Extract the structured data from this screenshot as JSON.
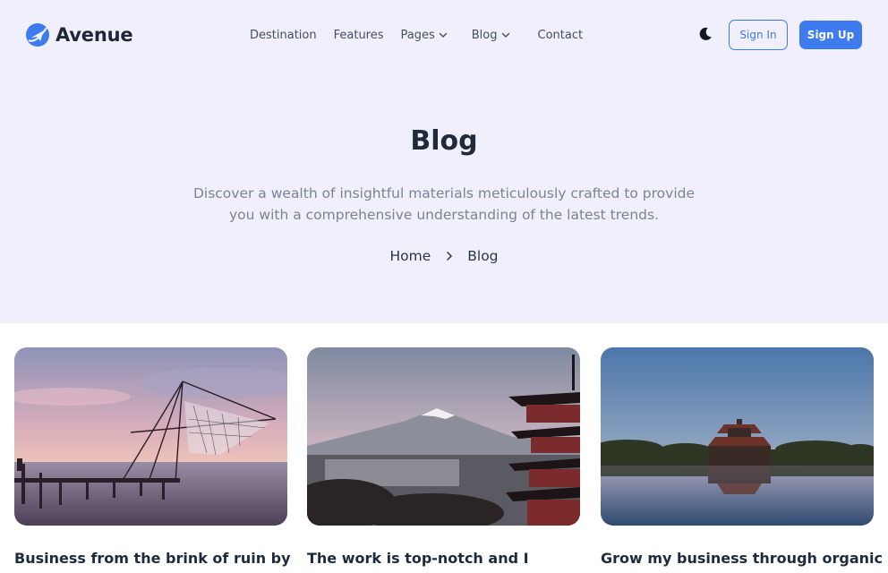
{
  "header": {
    "brand": "Avenue",
    "nav": [
      {
        "label": "Destination"
      },
      {
        "label": "Features"
      },
      {
        "label": "Pages"
      },
      {
        "label": "Blog"
      },
      {
        "label": "Contact"
      }
    ],
    "theme_icon": "moon-icon",
    "sign_in_label": "Sign In",
    "sign_up_label": "Sign Up"
  },
  "hero": {
    "title": "Blog",
    "subtitle_line1": "Discover a wealth of insightful materials meticulously crafted to provide",
    "subtitle_line2": "you with a comprehensive understanding of the latest trends.",
    "breadcrumb": {
      "home": "Home",
      "current": "Blog"
    }
  },
  "posts": [
    {
      "title": "Business from the brink of ruin by"
    },
    {
      "title": "The work is top-notch and I"
    },
    {
      "title": "Grow my business through organic"
    }
  ],
  "colors": {
    "accent": "#3d7bef",
    "hero_bg": "#f0effb",
    "heading": "#1e2b3c",
    "muted": "#7a8492"
  }
}
